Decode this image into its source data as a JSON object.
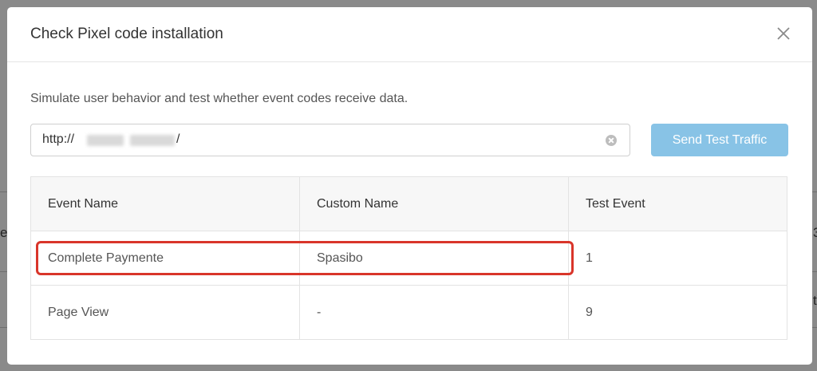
{
  "background": {
    "fragments": [
      "e",
      "3",
      "t"
    ]
  },
  "dialog": {
    "title": "Check Pixel code installation",
    "close_icon": "close-icon"
  },
  "description": "Simulate user behavior and test whether event codes receive data.",
  "url_input": {
    "prefix": "http://",
    "suffix": "/",
    "clear_icon": "clear-icon"
  },
  "send_button": {
    "label": "Send Test Traffic",
    "color": "#88c3e6"
  },
  "table": {
    "headers": [
      "Event Name",
      "Custom Name",
      "Test Event"
    ],
    "rows": [
      {
        "event_name": "Complete Paymente",
        "custom_name": "Spasibo",
        "test_event": "1"
      },
      {
        "event_name": "Page View",
        "custom_name": "-",
        "test_event": "9"
      }
    ]
  },
  "highlight": {
    "color": "#d9352a"
  }
}
